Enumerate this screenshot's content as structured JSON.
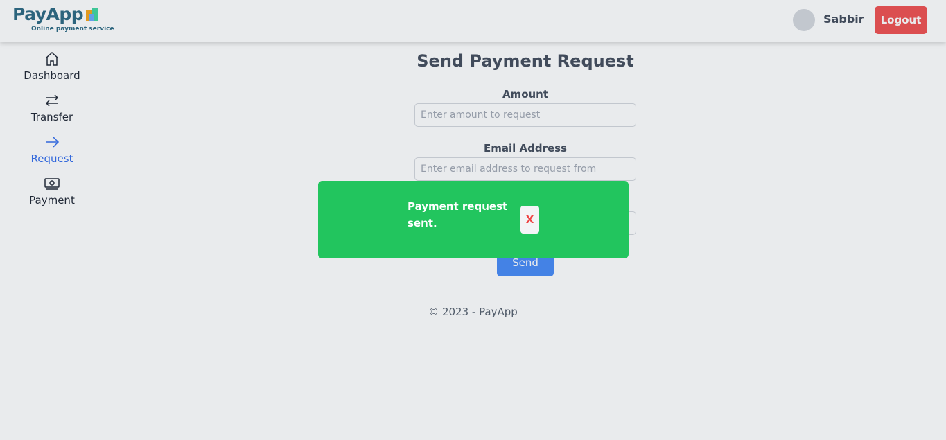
{
  "header": {
    "logo_title": "PayApp",
    "logo_subtitle": "Online payment service",
    "user_name": "Sabbir",
    "logout_label": "Logout"
  },
  "sidebar": {
    "items": [
      {
        "label": "Dashboard",
        "icon": "home-icon",
        "active": false
      },
      {
        "label": "Transfer",
        "icon": "transfer-icon",
        "active": false
      },
      {
        "label": "Request",
        "icon": "arrow-right-icon",
        "active": true
      },
      {
        "label": "Payment",
        "icon": "banknote-icon",
        "active": false
      }
    ]
  },
  "main": {
    "title": "Send Payment Request",
    "amount": {
      "label": "Amount",
      "placeholder": "Enter amount to request",
      "value": ""
    },
    "email": {
      "label": "Email Address",
      "placeholder": "Enter email address to request from",
      "value": ""
    },
    "send_label": "Send"
  },
  "footer": {
    "text": "© 2023 - PayApp"
  },
  "toast": {
    "message": "Payment request sent.",
    "close_label": "X",
    "color": "#22c55e"
  },
  "colors": {
    "brand": "#1e5f7a",
    "accent": "#2563eb",
    "danger": "#ef4444",
    "success": "#22c55e"
  }
}
